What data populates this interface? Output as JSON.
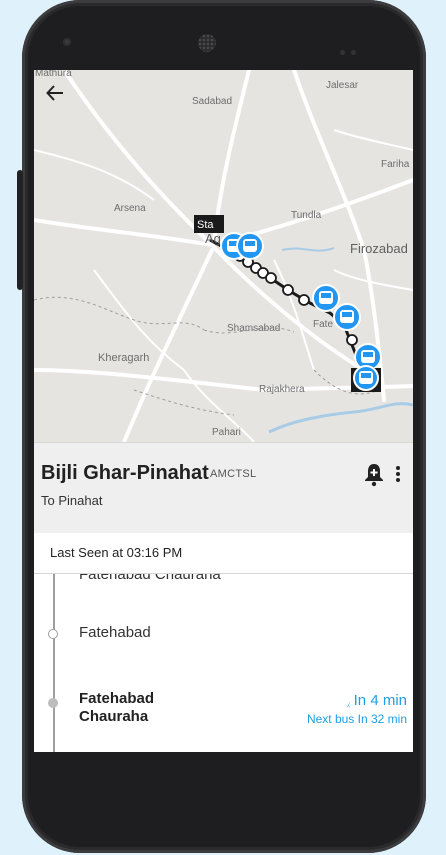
{
  "map": {
    "labels": {
      "mathura": "Mathura",
      "jalesar": "Jalesar",
      "sadabad": "Sadabad",
      "fariha": "Fariha",
      "arsena": "Arsena",
      "tundla": "Tundla",
      "firozabad": "Firozabad",
      "agra": "Ag",
      "shamsabad": "Shamsabad",
      "fatehabad": "Fate",
      "kheragarh": "Kheragarh",
      "rajakhera": "Rajakhera",
      "pahari": "Pahari"
    },
    "start_marker": "Sta"
  },
  "route": {
    "name": "Bijli Ghar-Pinahat",
    "agency": "AMCTSL",
    "destination": "To Pinahat"
  },
  "last_seen": "Last Seen at 03:16 PM",
  "stops": {
    "partial": "Fatehabad Chauraha",
    "items": [
      {
        "name": "Fatehabad"
      },
      {
        "name_line1": "Fatehabad",
        "name_line2": "Chauraha",
        "arrival": "In 4 min",
        "next_bus": "Next bus In 32 min"
      }
    ]
  },
  "colors": {
    "accent": "#1e9fe0",
    "bus_marker": "#2196f3"
  }
}
